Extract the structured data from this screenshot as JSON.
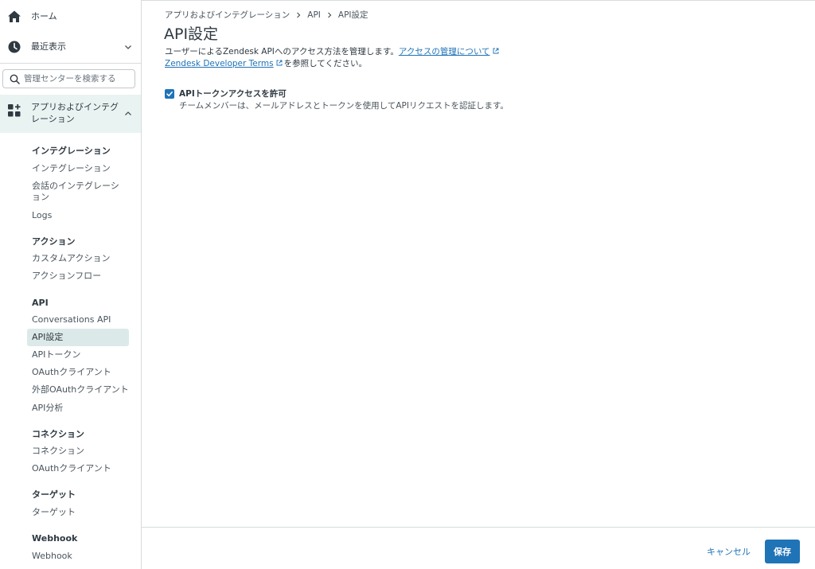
{
  "sidebar": {
    "home_label": "ホーム",
    "recent_label": "最近表示",
    "search_placeholder": "管理センターを検索する",
    "apps_label": "アプリおよびインテグレーション",
    "sections": [
      {
        "title": "インテグレーション",
        "items": [
          "インテグレーション",
          "会話のインテグレーション",
          "Logs"
        ]
      },
      {
        "title": "アクション",
        "items": [
          "カスタムアクション",
          "アクションフロー"
        ]
      },
      {
        "title": "API",
        "items": [
          "Conversations API",
          "API設定",
          "APIトークン",
          "OAuthクライアント",
          "外部OAuthクライアント",
          "API分析"
        ]
      },
      {
        "title": "コネクション",
        "items": [
          "コネクション",
          "OAuthクライアント"
        ]
      },
      {
        "title": "ターゲット",
        "items": [
          "ターゲット"
        ]
      },
      {
        "title": "Webhook",
        "items": [
          "Webhook"
        ]
      }
    ],
    "active_item": "API設定"
  },
  "breadcrumb": [
    "アプリおよびインテグレーション",
    "API",
    "API設定"
  ],
  "page": {
    "title": "API設定",
    "desc_prefix": "ユーザーによるZendesk APIへのアクセス方法を管理します。",
    "desc_link": "アクセスの管理について",
    "terms_link": "Zendesk Developer Terms",
    "terms_suffix": "を参照してください。",
    "checkbox_label": "APIトークンアクセスを許可",
    "checkbox_checked": true,
    "checkbox_hint": "チームメンバーは、メールアドレスとトークンを使用してAPIリクエストを認証します。"
  },
  "footer": {
    "cancel_label": "キャンセル",
    "save_label": "保存"
  },
  "colors": {
    "accent": "#1f73b7",
    "active_bg": "#e9f4f2",
    "active_item_bg": "#dce9e9"
  }
}
